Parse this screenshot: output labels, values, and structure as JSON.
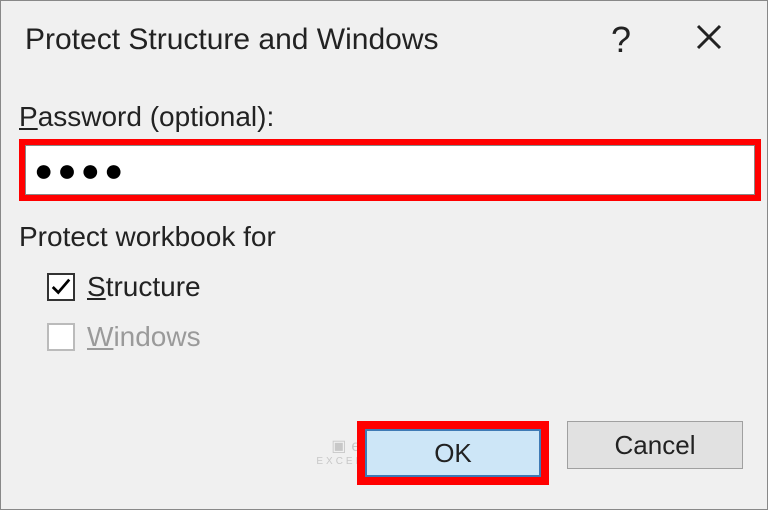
{
  "titlebar": {
    "title": "Protect Structure and Windows",
    "help": "?",
    "close": "×"
  },
  "password": {
    "label_prefix": "P",
    "label_rest": "assword (optional):",
    "value": "●●●●"
  },
  "protect": {
    "label": "Protect workbook for",
    "structure": {
      "prefix": "S",
      "rest": "tructure",
      "checked": true
    },
    "windows": {
      "prefix": "W",
      "rest": "indows",
      "checked": false,
      "disabled": true
    }
  },
  "buttons": {
    "ok": "OK",
    "cancel": "Cancel"
  },
  "watermark": {
    "main": "exceldemy",
    "sub": "EXCEL · DATA · BI"
  }
}
